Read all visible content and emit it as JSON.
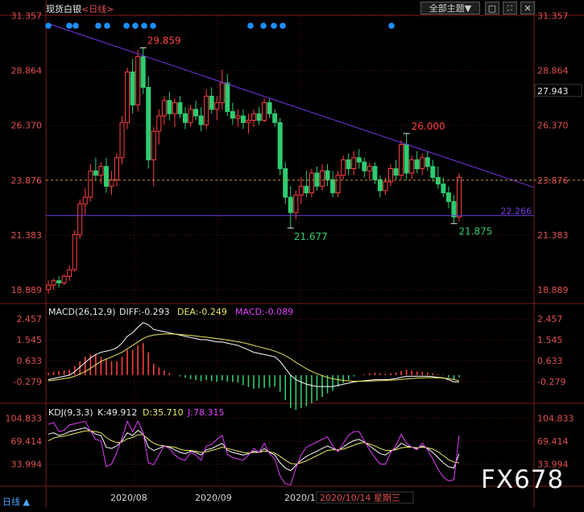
{
  "header": {
    "instrument": "现货白银",
    "period_label": "<日线>",
    "theme_button": "全部主题▼",
    "colors": {
      "price_up": "#ff4040",
      "price_down": "#2ecc71",
      "axis_text": "#e05050",
      "grid": "#5a1414",
      "trendline": "#7b35e8",
      "support": "#6f3fe0",
      "dashed": "#c0a030"
    }
  },
  "main_panel": {
    "y_ticks": [
      "31.357",
      "28.864",
      "26.370",
      "23.876",
      "21.383",
      "18.889"
    ],
    "y_tick_values": [
      31.357,
      28.864,
      26.37,
      23.876,
      21.383,
      18.889
    ],
    "last_price_label": "27.943",
    "support_label": "22.266",
    "annotations": {
      "high": "29.859",
      "trend_touch": "26.000",
      "low1": "21.677",
      "low2": "21.875"
    },
    "signal_dot_color": "#1e90ff"
  },
  "macd_panel": {
    "header": {
      "title": "MACD(26,12,9)",
      "diff": "DIFF:-0.293",
      "dea": "DEA:-0.249",
      "macd": "MACD:-0.089"
    },
    "y_ticks": [
      "2.457",
      "1.545",
      "0.633",
      "-0.279"
    ]
  },
  "kdj_panel": {
    "header": {
      "title": "KDJ(9,3,3)",
      "k": "K:49.912",
      "d": "D:35.710",
      "j": "J:78.315"
    },
    "y_ticks": [
      "104.833",
      "69.414",
      "33.994"
    ]
  },
  "x_axis": {
    "labels": [
      "2020/08",
      "2020/09",
      "2020/1(",
      "2020/10/14 星期三"
    ]
  },
  "footer": {
    "left": "日线 ▲"
  },
  "watermark": "FX678",
  "chart_data": [
    {
      "type": "candlestick",
      "title": "现货白银 日线",
      "ylim": [
        18.3,
        31.6
      ],
      "ohlc": [
        [
          18.9,
          19.3,
          18.7,
          19.1
        ],
        [
          19.1,
          19.4,
          18.9,
          19.3
        ],
        [
          19.3,
          19.5,
          19.0,
          19.2
        ],
        [
          19.2,
          19.6,
          19.1,
          19.5
        ],
        [
          19.5,
          20.0,
          19.3,
          19.8
        ],
        [
          19.8,
          21.6,
          19.7,
          21.4
        ],
        [
          21.4,
          23.0,
          21.2,
          22.8
        ],
        [
          22.8,
          23.5,
          22.3,
          23.1
        ],
        [
          23.1,
          24.6,
          22.9,
          24.3
        ],
        [
          24.3,
          24.9,
          23.9,
          24.1
        ],
        [
          24.1,
          24.7,
          23.7,
          24.5
        ],
        [
          24.5,
          24.9,
          23.3,
          23.6
        ],
        [
          23.6,
          24.3,
          23.2,
          23.9
        ],
        [
          23.9,
          25.1,
          23.6,
          24.9
        ],
        [
          24.9,
          26.8,
          24.6,
          26.5
        ],
        [
          26.5,
          29.0,
          26.2,
          28.8
        ],
        [
          28.8,
          29.4,
          26.9,
          27.3
        ],
        [
          27.3,
          29.8,
          27.0,
          29.5
        ],
        [
          29.5,
          29.9,
          27.8,
          28.1
        ],
        [
          28.1,
          28.6,
          24.4,
          24.8
        ],
        [
          24.8,
          26.3,
          23.6,
          26.1
        ],
        [
          26.1,
          27.1,
          25.5,
          26.8
        ],
        [
          26.8,
          27.7,
          26.4,
          27.5
        ],
        [
          27.5,
          27.9,
          26.6,
          26.9
        ],
        [
          26.9,
          27.6,
          26.3,
          27.4
        ],
        [
          27.4,
          27.7,
          26.7,
          26.9
        ],
        [
          26.9,
          27.2,
          26.2,
          26.5
        ],
        [
          26.5,
          27.3,
          26.3,
          27.1
        ],
        [
          27.1,
          27.5,
          26.6,
          26.8
        ],
        [
          26.8,
          27.2,
          26.1,
          26.4
        ],
        [
          26.4,
          28.0,
          26.2,
          27.7
        ],
        [
          27.7,
          28.1,
          26.9,
          27.1
        ],
        [
          27.1,
          27.7,
          26.6,
          27.4
        ],
        [
          27.4,
          28.9,
          27.1,
          28.3
        ],
        [
          28.3,
          28.7,
          26.8,
          27.0
        ],
        [
          27.0,
          27.4,
          26.4,
          26.7
        ],
        [
          26.7,
          27.1,
          26.3,
          26.8
        ],
        [
          26.8,
          27.1,
          26.2,
          26.5
        ],
        [
          26.5,
          26.9,
          26.0,
          26.6
        ],
        [
          26.6,
          27.1,
          26.3,
          26.9
        ],
        [
          26.9,
          27.2,
          26.4,
          26.6
        ],
        [
          26.6,
          27.6,
          26.5,
          27.4
        ],
        [
          27.4,
          27.6,
          26.7,
          26.9
        ],
        [
          26.9,
          27.1,
          26.3,
          26.5
        ],
        [
          26.5,
          26.7,
          24.1,
          24.4
        ],
        [
          24.4,
          24.7,
          22.8,
          23.1
        ],
        [
          23.1,
          23.6,
          21.7,
          22.4
        ],
        [
          22.4,
          23.4,
          22.1,
          23.2
        ],
        [
          23.2,
          24.0,
          22.8,
          23.6
        ],
        [
          23.6,
          24.3,
          23.1,
          23.3
        ],
        [
          23.3,
          24.4,
          23.1,
          24.2
        ],
        [
          24.2,
          24.5,
          23.4,
          23.6
        ],
        [
          23.6,
          24.6,
          23.4,
          24.3
        ],
        [
          24.3,
          24.6,
          23.6,
          23.9
        ],
        [
          23.9,
          24.3,
          23.1,
          23.3
        ],
        [
          23.3,
          24.3,
          23.1,
          24.1
        ],
        [
          24.1,
          25.0,
          23.9,
          24.8
        ],
        [
          24.8,
          25.1,
          24.1,
          24.4
        ],
        [
          24.4,
          25.2,
          24.1,
          24.9
        ],
        [
          24.9,
          25.3,
          24.4,
          24.7
        ],
        [
          24.7,
          24.9,
          24.0,
          24.3
        ],
        [
          24.3,
          24.7,
          23.9,
          24.5
        ],
        [
          24.5,
          24.7,
          23.7,
          23.9
        ],
        [
          23.9,
          24.1,
          23.1,
          23.4
        ],
        [
          23.4,
          24.0,
          23.2,
          23.8
        ],
        [
          23.8,
          24.6,
          23.6,
          24.4
        ],
        [
          24.4,
          24.8,
          23.9,
          24.1
        ],
        [
          24.1,
          25.7,
          23.9,
          25.5
        ],
        [
          25.5,
          26.0,
          23.9,
          24.2
        ],
        [
          24.2,
          25.0,
          23.9,
          24.8
        ],
        [
          24.8,
          25.2,
          24.2,
          24.4
        ],
        [
          24.4,
          25.1,
          24.1,
          24.9
        ],
        [
          24.9,
          25.2,
          24.3,
          24.5
        ],
        [
          24.5,
          24.8,
          23.8,
          24.0
        ],
        [
          24.0,
          24.5,
          23.5,
          23.7
        ],
        [
          23.7,
          24.0,
          23.1,
          23.3
        ],
        [
          23.3,
          23.6,
          22.6,
          22.9
        ],
        [
          22.9,
          23.2,
          21.9,
          22.2
        ],
        [
          22.2,
          24.2,
          22.0,
          24.0
        ]
      ]
    },
    {
      "type": "line",
      "title": "MACD(26,12,9)",
      "ylim": [
        -1.2,
        3.1
      ],
      "series": [
        {
          "name": "DIFF",
          "color": "#ffffff",
          "values": [
            -0.2,
            -0.15,
            -0.1,
            -0.05,
            0.0,
            0.15,
            0.35,
            0.55,
            0.75,
            0.9,
            1.0,
            1.05,
            1.1,
            1.2,
            1.4,
            1.7,
            1.85,
            2.1,
            2.3,
            2.2,
            2.0,
            1.95,
            1.9,
            1.85,
            1.8,
            1.75,
            1.7,
            1.65,
            1.6,
            1.55,
            1.55,
            1.5,
            1.45,
            1.45,
            1.4,
            1.35,
            1.3,
            1.2,
            1.1,
            1.0,
            0.95,
            0.9,
            0.85,
            0.8,
            0.6,
            0.3,
            0.0,
            -0.2,
            -0.3,
            -0.4,
            -0.45,
            -0.5,
            -0.5,
            -0.5,
            -0.5,
            -0.45,
            -0.4,
            -0.35,
            -0.3,
            -0.27,
            -0.25,
            -0.22,
            -0.2,
            -0.2,
            -0.2,
            -0.18,
            -0.15,
            -0.1,
            -0.05,
            -0.05,
            -0.05,
            -0.05,
            -0.05,
            -0.07,
            -0.1,
            -0.12,
            -0.2,
            -0.3,
            -0.29
          ]
        },
        {
          "name": "DEA",
          "color": "#e8e85a",
          "values": [
            -0.25,
            -0.22,
            -0.19,
            -0.15,
            -0.12,
            -0.05,
            0.05,
            0.15,
            0.3,
            0.45,
            0.6,
            0.7,
            0.8,
            0.9,
            1.0,
            1.15,
            1.3,
            1.45,
            1.6,
            1.7,
            1.75,
            1.78,
            1.8,
            1.8,
            1.8,
            1.78,
            1.76,
            1.74,
            1.71,
            1.68,
            1.66,
            1.63,
            1.6,
            1.57,
            1.54,
            1.5,
            1.46,
            1.42,
            1.36,
            1.3,
            1.24,
            1.18,
            1.12,
            1.05,
            0.96,
            0.85,
            0.72,
            0.56,
            0.42,
            0.28,
            0.16,
            0.06,
            -0.02,
            -0.1,
            -0.16,
            -0.2,
            -0.23,
            -0.25,
            -0.27,
            -0.27,
            -0.27,
            -0.26,
            -0.25,
            -0.24,
            -0.23,
            -0.22,
            -0.21,
            -0.19,
            -0.17,
            -0.15,
            -0.13,
            -0.12,
            -0.11,
            -0.11,
            -0.12,
            -0.13,
            -0.15,
            -0.2,
            -0.25
          ]
        }
      ],
      "macd_bars": [
        0.1,
        0.15,
        0.18,
        0.2,
        0.24,
        0.4,
        0.6,
        0.8,
        0.9,
        0.9,
        0.8,
        0.7,
        0.6,
        0.6,
        0.8,
        1.1,
        1.1,
        1.3,
        1.4,
        1.0,
        0.5,
        0.34,
        0.2,
        0.1,
        0.0,
        -0.06,
        -0.12,
        -0.18,
        -0.22,
        -0.26,
        -0.22,
        -0.26,
        -0.3,
        -0.24,
        -0.28,
        -0.3,
        -0.32,
        -0.44,
        -0.52,
        -0.6,
        -0.58,
        -0.56,
        -0.54,
        -0.5,
        -0.72,
        -1.1,
        -1.44,
        -1.52,
        -1.44,
        -1.36,
        -1.22,
        -1.12,
        -0.96,
        -0.8,
        -0.68,
        -0.5,
        -0.34,
        -0.2,
        -0.06,
        0.0,
        0.04,
        0.08,
        0.1,
        0.08,
        0.06,
        0.08,
        0.12,
        0.18,
        0.24,
        0.2,
        0.16,
        0.14,
        0.12,
        0.08,
        0.04,
        0.02,
        -0.1,
        -0.2,
        -0.09
      ]
    },
    {
      "type": "line",
      "title": "KDJ(9,3,3)",
      "ylim": [
        0,
        120
      ],
      "series": [
        {
          "name": "K",
          "color": "#ffffff",
          "values": [
            80,
            82,
            78,
            80,
            84,
            86,
            88,
            90,
            85,
            80,
            78,
            60,
            58,
            62,
            70,
            82,
            78,
            86,
            80,
            60,
            55,
            58,
            62,
            60,
            56,
            52,
            50,
            54,
            52,
            48,
            56,
            58,
            62,
            66,
            55,
            52,
            50,
            48,
            50,
            54,
            52,
            58,
            52,
            48,
            36,
            28,
            24,
            32,
            40,
            46,
            50,
            54,
            58,
            62,
            58,
            55,
            60,
            66,
            70,
            72,
            68,
            62,
            56,
            50,
            48,
            54,
            58,
            66,
            62,
            60,
            58,
            62,
            58,
            52,
            44,
            36,
            30,
            28,
            50
          ]
        },
        {
          "name": "D",
          "color": "#e8e85a",
          "values": [
            70,
            74,
            76,
            77,
            79,
            81,
            83,
            85,
            85,
            84,
            82,
            75,
            70,
            67,
            68,
            73,
            75,
            79,
            79,
            72,
            66,
            63,
            62,
            61,
            60,
            57,
            55,
            55,
            54,
            52,
            53,
            55,
            57,
            60,
            58,
            56,
            54,
            52,
            51,
            52,
            52,
            54,
            53,
            51,
            46,
            40,
            35,
            34,
            36,
            39,
            43,
            47,
            51,
            55,
            56,
            56,
            57,
            60,
            63,
            66,
            67,
            65,
            62,
            58,
            55,
            55,
            56,
            59,
            60,
            60,
            59,
            60,
            59,
            57,
            53,
            47,
            41,
            37,
            36
          ]
        },
        {
          "name": "J",
          "color": "#e040fb",
          "values": [
            95,
            98,
            84,
            86,
            94,
            96,
            98,
            100,
            85,
            72,
            70,
            30,
            34,
            52,
            74,
            100,
            84,
            100,
            82,
            36,
            33,
            48,
            62,
            58,
            48,
            42,
            40,
            52,
            48,
            40,
            62,
            64,
            72,
            78,
            49,
            44,
            42,
            40,
            48,
            58,
            52,
            66,
            50,
            42,
            16,
            4,
            2,
            28,
            48,
            60,
            64,
            68,
            72,
            76,
            62,
            53,
            66,
            78,
            84,
            84,
            70,
            56,
            44,
            34,
            34,
            52,
            62,
            80,
            66,
            60,
            56,
            66,
            56,
            42,
            26,
            14,
            8,
            10,
            78
          ]
        }
      ]
    }
  ]
}
